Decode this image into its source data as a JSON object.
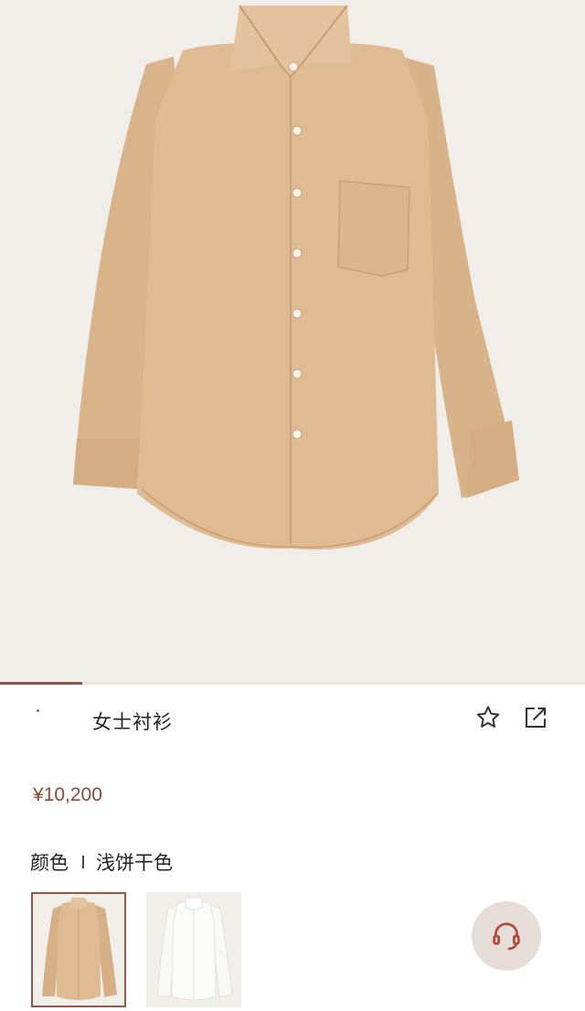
{
  "product": {
    "title": "女士衬衫",
    "price": "¥10,200",
    "color_label": "颜色",
    "color_value": "浅饼干色"
  },
  "gallery": {
    "progress": 0.14
  },
  "icons": {
    "favorite": "star-icon",
    "share": "share-icon",
    "support": "headset-icon"
  },
  "colors": {
    "accent": "#8a5a4a",
    "price": "#8a4a3b",
    "shirt": "#dfbb93",
    "hero_bg": "#f1eee9"
  },
  "swatches": [
    {
      "name": "beige",
      "selected": true
    },
    {
      "name": "white",
      "selected": false
    }
  ]
}
